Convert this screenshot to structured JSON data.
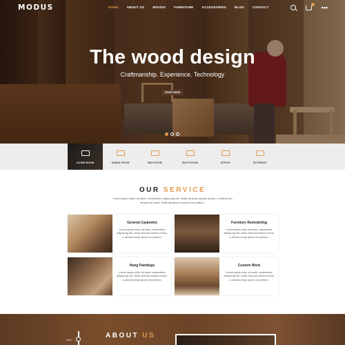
{
  "brand": {
    "logo": "MODUS",
    "accent": "#e09a4c"
  },
  "nav": {
    "items": [
      {
        "label": "HOME",
        "active": true
      },
      {
        "label": "ABOUT US",
        "active": false
      },
      {
        "label": "WOODS",
        "active": false
      },
      {
        "label": "FURNITURE",
        "active": false
      },
      {
        "label": "ACCESSORIES",
        "active": false
      },
      {
        "label": "BLOG",
        "active": false
      },
      {
        "label": "CONTACT",
        "active": false
      }
    ],
    "icons": [
      "search-icon",
      "cart-icon",
      "more-icon"
    ],
    "more_glyph": "•••"
  },
  "hero": {
    "title": "The wood design",
    "subtitle": "Craftmanship. Experience. Technology",
    "button": "SHOP NOW",
    "slides": 3,
    "active_slide": 1
  },
  "categories": [
    {
      "label": "LIVING ROOM",
      "active": true,
      "icon": "sofa-icon"
    },
    {
      "label": "DINING ROOM",
      "active": false,
      "icon": "dining-table-icon"
    },
    {
      "label": "BED ROOM",
      "active": false,
      "icon": "bed-icon"
    },
    {
      "label": "BATH ROOM",
      "active": false,
      "icon": "bathtub-icon"
    },
    {
      "label": "OFFICE",
      "active": false,
      "icon": "office-chair-icon"
    },
    {
      "label": "EXTERIOR",
      "active": false,
      "icon": "fence-icon"
    }
  ],
  "service": {
    "title_1": "OUR",
    "title_2": "SERVICE",
    "description": "Lorem ipsum dolor sit amet, consectetur adipiscing elit. Nulla vehicula mauris metus, a ultrices leo tempus sit amet. Nulla faucibus ut ipsum vel pretium.",
    "cards": [
      {
        "title": "General Carpentry",
        "text": "Lorem ipsum dolor sit amet, consectetur adipiscing elit. Nulla vehicula mauris metus, a ultrices templ ipsum vel pretium."
      },
      {
        "title": "Furniture Remodeling",
        "text": "Lorem ipsum dolor sit amet, consectetur adipiscing elit. Nulla vehicula mauris metus, a ultrices templ ipsum vel pretium."
      },
      {
        "title": "Hang Paintings",
        "text": "Lorem ipsum dolor sit amet, consectetur adipiscing elit. Nulla vehicula mauris metus, a ultrices templ ipsum vel pretium."
      },
      {
        "title": "Custom Work",
        "text": "Lorem ipsum dolor sit amet, consectetur adipiscing elit. Nulla vehicula mauris metus, a ultrices templ ipsum vel pretium."
      }
    ]
  },
  "about": {
    "year": "2017",
    "title_1": "ABOUT",
    "title_2": "US"
  }
}
